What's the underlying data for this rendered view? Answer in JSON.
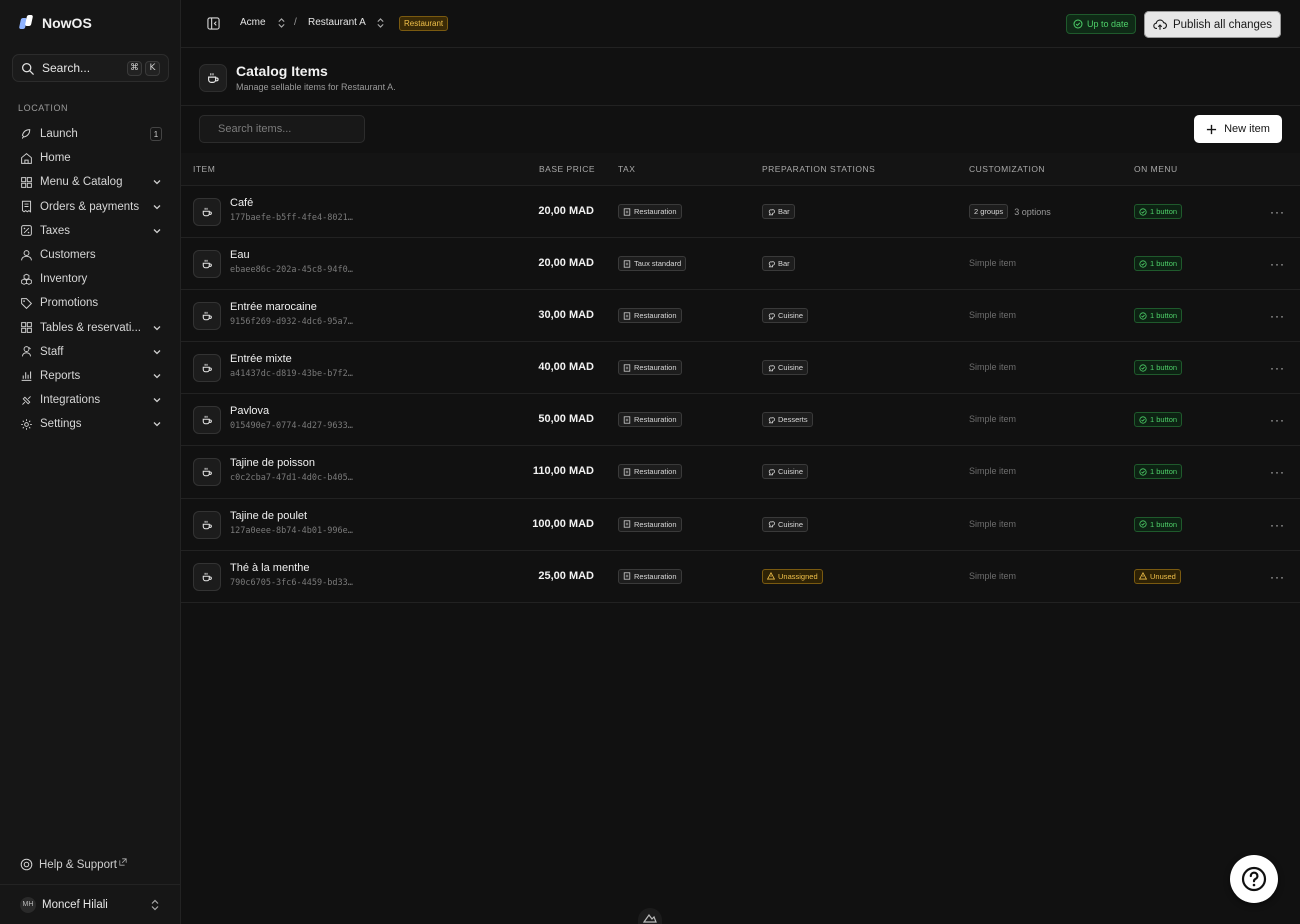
{
  "app": {
    "name": "NowOS"
  },
  "sidebar": {
    "search_label": "Search...",
    "shortcut": [
      "⌘",
      "K"
    ],
    "section_label": "LOCATION",
    "items": [
      {
        "label": "Launch",
        "icon": "rocket-icon",
        "badge": "1"
      },
      {
        "label": "Home",
        "icon": "home-icon"
      },
      {
        "label": "Menu & Catalog",
        "icon": "grid-icon",
        "expandable": true
      },
      {
        "label": "Orders & payments",
        "icon": "receipt-icon",
        "expandable": true
      },
      {
        "label": "Taxes",
        "icon": "tax-icon",
        "expandable": true
      },
      {
        "label": "Customers",
        "icon": "user-icon"
      },
      {
        "label": "Inventory",
        "icon": "boxes-icon"
      },
      {
        "label": "Promotions",
        "icon": "tag-icon"
      },
      {
        "label": "Tables & reservati...",
        "icon": "tables-icon",
        "expandable": true
      },
      {
        "label": "Staff",
        "icon": "staff-icon",
        "expandable": true
      },
      {
        "label": "Reports",
        "icon": "chart-icon",
        "expandable": true
      },
      {
        "label": "Integrations",
        "icon": "plug-icon",
        "expandable": true
      },
      {
        "label": "Settings",
        "icon": "gear-icon",
        "expandable": true
      }
    ],
    "help_label": "Help & Support",
    "user": {
      "initials": "MH",
      "name": "Moncef Hilali"
    }
  },
  "topbar": {
    "org": "Acme",
    "separator": "/",
    "location": "Restaurant A",
    "location_badge": "Restaurant",
    "status": "Up to date",
    "publish_label": "Publish all changes"
  },
  "page": {
    "title": "Catalog Items",
    "subtitle": "Manage sellable items for Restaurant A.",
    "search_placeholder": "Search items...",
    "new_item_label": "New item"
  },
  "table": {
    "headers": {
      "item": "ITEM",
      "base_price": "BASE PRICE",
      "tax": "TAX",
      "stations": "PREPARATION STATIONS",
      "customization": "CUSTOMIZATION",
      "on_menu": "ON MENU"
    },
    "rows": [
      {
        "name": "Café",
        "id": "177baefe-b5ff-4fe4-8021…",
        "price": "20,00 MAD",
        "tax": "Restauration",
        "station": "Bar",
        "station_warn": false,
        "groups": "2 groups",
        "options": "3 options",
        "customization": "",
        "menu": "1 button",
        "menu_warn": false
      },
      {
        "name": "Eau",
        "id": "ebaee86c-202a-45c8-94f0…",
        "price": "20,00 MAD",
        "tax": "Taux standard",
        "station": "Bar",
        "station_warn": false,
        "groups": "",
        "options": "",
        "customization": "Simple item",
        "menu": "1 button",
        "menu_warn": false
      },
      {
        "name": "Entrée marocaine",
        "id": "9156f269-d932-4dc6-95a7…",
        "price": "30,00 MAD",
        "tax": "Restauration",
        "station": "Cuisine",
        "station_warn": false,
        "groups": "",
        "options": "",
        "customization": "Simple item",
        "menu": "1 button",
        "menu_warn": false
      },
      {
        "name": "Entrée mixte",
        "id": "a41437dc-d819-43be-b7f2…",
        "price": "40,00 MAD",
        "tax": "Restauration",
        "station": "Cuisine",
        "station_warn": false,
        "groups": "",
        "options": "",
        "customization": "Simple item",
        "menu": "1 button",
        "menu_warn": false
      },
      {
        "name": "Pavlova",
        "id": "015490e7-0774-4d27-9633…",
        "price": "50,00 MAD",
        "tax": "Restauration",
        "station": "Desserts",
        "station_warn": false,
        "groups": "",
        "options": "",
        "customization": "Simple item",
        "menu": "1 button",
        "menu_warn": false
      },
      {
        "name": "Tajine de poisson",
        "id": "c0c2cba7-47d1-4d0c-b405…",
        "price": "110,00 MAD",
        "tax": "Restauration",
        "station": "Cuisine",
        "station_warn": false,
        "groups": "",
        "options": "",
        "customization": "Simple item",
        "menu": "1 button",
        "menu_warn": false
      },
      {
        "name": "Tajine de poulet",
        "id": "127a0eee-8b74-4b01-996e…",
        "price": "100,00 MAD",
        "tax": "Restauration",
        "station": "Cuisine",
        "station_warn": false,
        "groups": "",
        "options": "",
        "customization": "Simple item",
        "menu": "1 button",
        "menu_warn": false
      },
      {
        "name": "Thé à la menthe",
        "id": "790c6705-3fc6-4459-bd33…",
        "price": "25,00 MAD",
        "tax": "Restauration",
        "station": "Unassigned",
        "station_warn": true,
        "groups": "",
        "options": "",
        "customization": "Simple item",
        "menu": "Unused",
        "menu_warn": true
      }
    ]
  },
  "colors": {
    "background": "#111111",
    "accent_green": "#4ed069",
    "accent_amber": "#f0c04a"
  }
}
